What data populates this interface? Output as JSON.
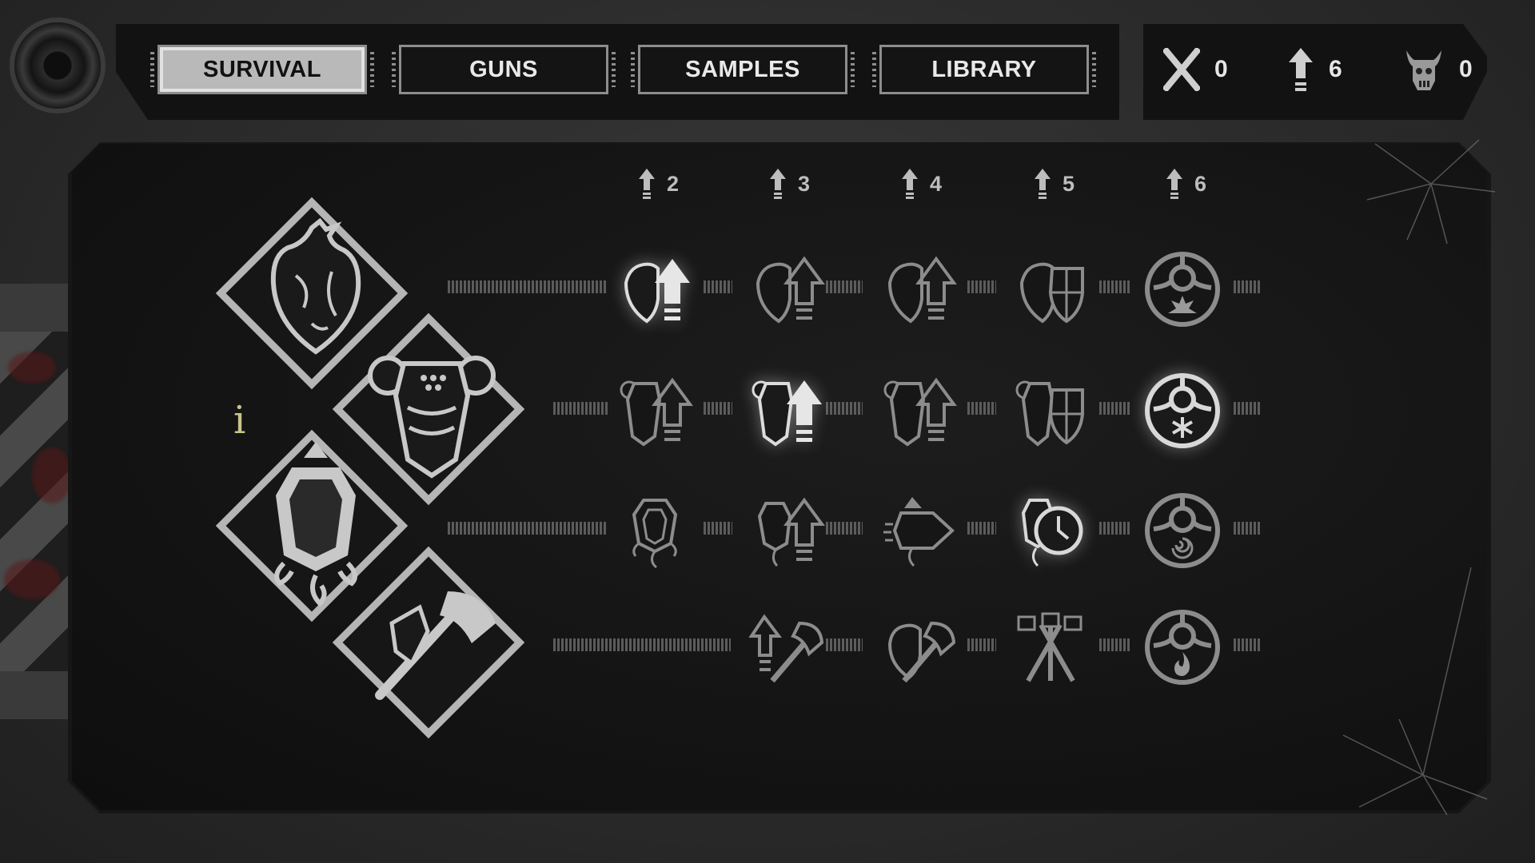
{
  "tabs": [
    {
      "label": "SURVIVAL",
      "active": true
    },
    {
      "label": "GUNS",
      "active": false
    },
    {
      "label": "SAMPLES",
      "active": false
    },
    {
      "label": "LIBRARY",
      "active": false
    }
  ],
  "counters": [
    {
      "icon": "crossed-x-icon",
      "value": "0"
    },
    {
      "icon": "upgrade-arrow-icon",
      "value": "6"
    },
    {
      "icon": "demon-skull-icon",
      "value": "0"
    }
  ],
  "tiers": [
    "2",
    "3",
    "4",
    "5",
    "6"
  ],
  "info_label": "i",
  "categories": [
    {
      "icon": "heart-icon"
    },
    {
      "icon": "armor-icon"
    },
    {
      "icon": "cocoon-icon"
    },
    {
      "icon": "axe-icon"
    }
  ],
  "skill_rows": [
    [
      "heart-upgrade-icon",
      "heart-upgrade-icon",
      "heart-upgrade-icon",
      "heart-shield-icon",
      "medallion-explosion-icon"
    ],
    [
      "armor-upgrade-icon",
      "armor-upgrade-icon",
      "armor-upgrade-icon",
      "armor-shield-icon",
      "medallion-frost-icon"
    ],
    [
      "cocoon-icon",
      "cocoon-upgrade-icon",
      "cocoon-dash-icon",
      "cocoon-clock-icon",
      "medallion-vortex-icon"
    ],
    [
      "",
      "axe-upgrade-icon",
      "axe-heart-icon",
      "triple-axe-icon",
      "medallion-fire-icon"
    ]
  ]
}
